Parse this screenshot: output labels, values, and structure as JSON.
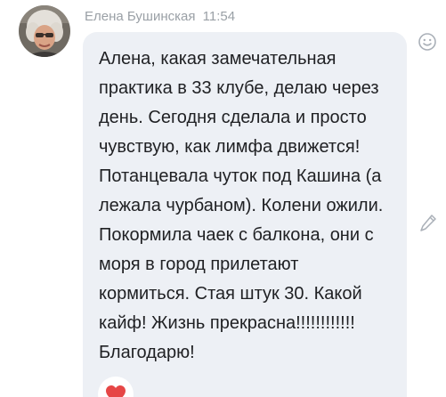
{
  "message": {
    "author": "Елена Бушинская",
    "time": "11:54",
    "lines": [
      "Алена, какая замечательная",
      "практика в 33 клубе, делаю через",
      "день. Сегодня сделала и просто",
      "чувствую, как лимфа движется!",
      "Потанцевала чуток под Кашина (а",
      "лежала чурбаном). Колени ожили.",
      "Покормила чаек с балкона, они с",
      "моря в город прилетают",
      "кормиться. Стая штук 30. Какой",
      "кайф! Жизнь прекрасна!!!!!!!!!!!!",
      "Благодарю!"
    ],
    "reaction": {
      "icon": "heart-icon",
      "color": "#e64646"
    }
  },
  "actions": {
    "emoji_icon": "smiley-icon",
    "edit_icon": "pencil-icon"
  },
  "colors": {
    "bubble": "#edf0f5",
    "meta_text": "#9aa0a6",
    "message_text": "#202124",
    "icon_gray": "#aab0b8"
  }
}
